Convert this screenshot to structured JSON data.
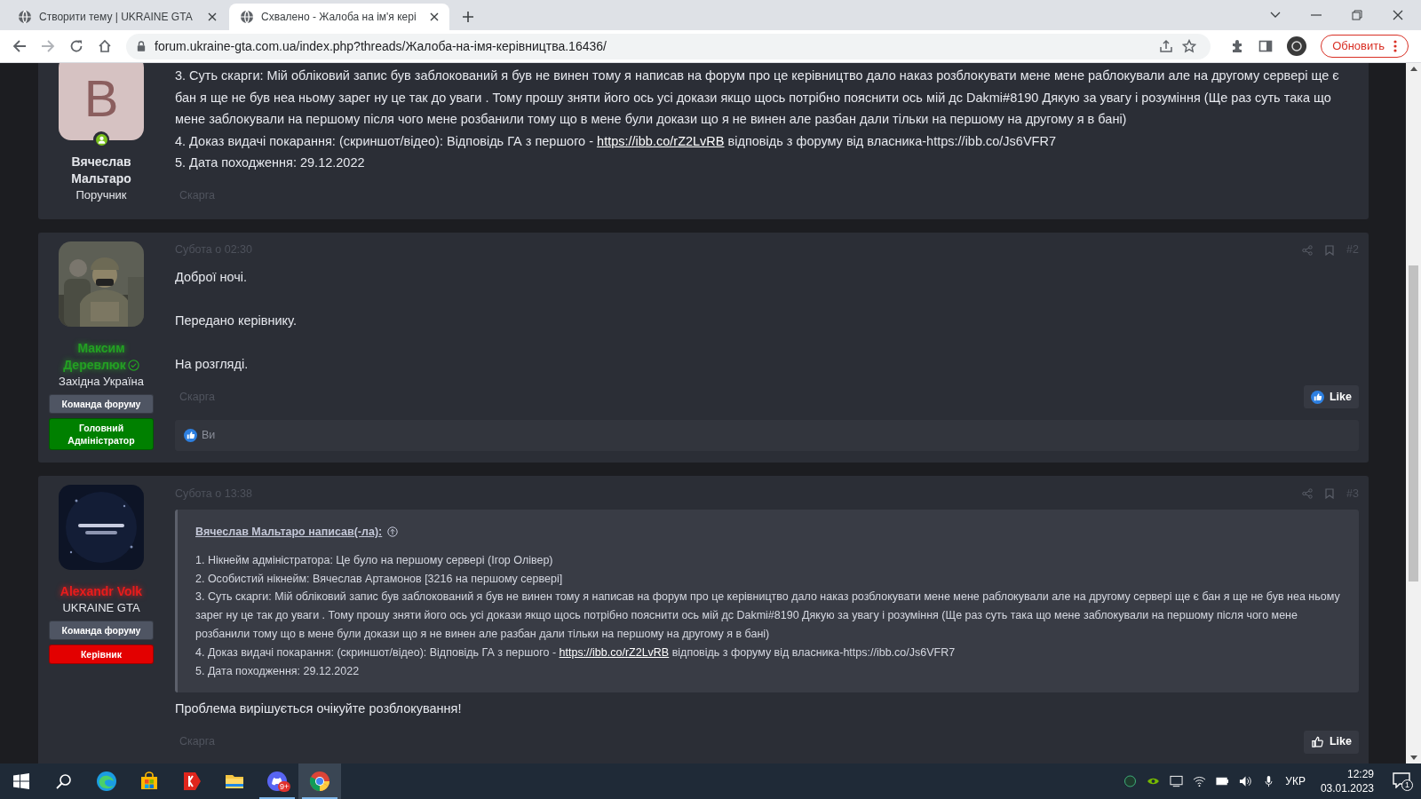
{
  "browser": {
    "tabs": [
      {
        "title": "Створити тему | UKRAINE GTA",
        "selected": false
      },
      {
        "title": "Схвалено - Жалоба на ім'я кері",
        "selected": true
      }
    ],
    "url": "forum.ukraine-gta.com.ua/index.php?threads/Жалоба-на-імя-керівництва.16436/",
    "update_button": "Обновить"
  },
  "posts": [
    {
      "author": {
        "name": "Вячеслав Мальтаро",
        "color": "#e4e6eb",
        "verified": false,
        "title": "Поручник",
        "avatar": {
          "kind": "letter",
          "letter": "B",
          "online": true
        }
      },
      "body": [
        [
          {
            "text": "3. Суть скарги: Мій обліковий запис був заблокований я був не винен тому я написав на форум про це керівництво дало наказ розблокувати мене мене раблокували але на другому сервері ще є бан я ще не був неа ньому зарег ну це так до уваги . Тому прошу зняти його ось усі докази якщо щось потрібно пояснити ось мій дс Dakmi#8190 Дякую за увагу і розуміння (Ще раз суть така що мене заблокували на першому після чого мене розбанили тому що в мене були докази що я не винен але разбан дали тільки на першому на другому я в бані)"
          }
        ],
        [
          {
            "text": "4. Доказ видачі покарання: (скриншот/відео): Відповідь ГА з першого - "
          },
          {
            "text": "https://ibb.co/rZ2LvRB",
            "kind": "link"
          },
          {
            "text": " відповідь з форуму від власника-https://ibb.co/Js6VFR7"
          }
        ],
        [
          {
            "text": "5. Дата походження: 29.12.2022"
          }
        ]
      ],
      "report": "Скарга"
    },
    {
      "author": {
        "name": "Максим Деревлюк",
        "color": "#23a023",
        "verified": true,
        "title": "Західна Україна",
        "badges": [
          {
            "label": "Команда форуму",
            "color": "#4f5563"
          },
          {
            "label": "Головний Адміністратор",
            "color": "#008000"
          }
        ]
      },
      "date": "Субота о 02:30",
      "number": "#2",
      "body": [
        [
          {
            "text": "Доброї ночі."
          }
        ],
        [
          {
            "text": "Передано керівнику."
          }
        ],
        [
          {
            "text": "На розгляді."
          }
        ]
      ],
      "report": "Скарга",
      "like": {
        "label": "Like",
        "liked": true
      },
      "reactions": "Ви"
    },
    {
      "author": {
        "name": "Alexandr Volk",
        "color": "#e81c1c",
        "verified": false,
        "title": "UKRAINE GTA",
        "badges": [
          {
            "label": "Команда форуму",
            "color": "#4f5563"
          },
          {
            "label": "Керівник",
            "color": "#e30000"
          }
        ]
      },
      "date": "Субота о 13:38",
      "number": "#3",
      "quote": {
        "author": "Вячеслав Мальтаро написав(-ла):",
        "lines": [
          [
            {
              "text": "1. Нікнейм адміністратора: Це було на першому сервері (Ігор Олівер)"
            }
          ],
          [
            {
              "text": "2. Особистий нікнейм: Вячеслав Артамонов [3216 на першому сервері]"
            }
          ],
          [
            {
              "text": "3. Суть скарги: Мій обліковий запис був заблокований я був не винен тому я написав на форум про це керівництво дало наказ розблокувати мене мене раблокували але на другому сервері ще є бан я ще не був неа ньому зарег ну це так до уваги . Тому прошу зняти його ось усі докази якщо щось потрібно пояснити ось мій дс Dakmi#8190 Дякую за увагу і розуміння (Ще раз суть така що мене заблокували на першому після чого мене розбанили тому що в мене були докази що я не винен але разбан дали тільки на першому на другому я в бані)"
            }
          ],
          [
            {
              "text": "4. Доказ видачі покарання: (скриншот/відео): Відповідь ГА з першого - "
            },
            {
              "text": "https://ibb.co/rZ2LvRB",
              "kind": "link"
            },
            {
              "text": " відповідь з форуму від власника-https://ibb.co/Js6VFR7"
            }
          ],
          [
            {
              "text": "5. Дата походження: 29.12.2022"
            }
          ]
        ]
      },
      "body": [
        [
          {
            "text": "Проблема вирішується очікуйте розблокування!"
          }
        ]
      ],
      "report": "Скарга",
      "like": {
        "label": "Like",
        "liked": false
      }
    }
  ],
  "taskbar": {
    "apps": [
      {
        "kind": "start",
        "running": false,
        "selected": false
      },
      {
        "kind": "search",
        "running": false,
        "selected": false
      },
      {
        "kind": "edge",
        "running": false,
        "selected": false
      },
      {
        "kind": "store",
        "running": false,
        "selected": false
      },
      {
        "kind": "yandex",
        "running": false,
        "selected": false
      },
      {
        "kind": "folder",
        "running": false,
        "selected": false
      },
      {
        "kind": "discord",
        "running": true,
        "selected": false,
        "badge": "9+"
      },
      {
        "kind": "chrome",
        "running": true,
        "selected": true
      }
    ],
    "language": "УКР",
    "time": "12:29",
    "date": "03.01.2023",
    "notifications": "1"
  }
}
